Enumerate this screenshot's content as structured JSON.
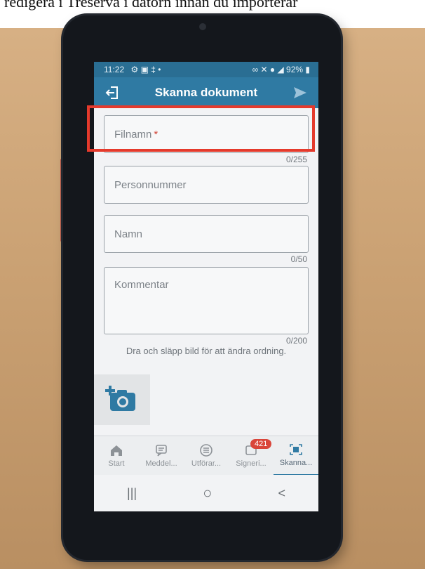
{
  "caption": {
    "text": "redigera i Treserva i datorn innan du importerar"
  },
  "statusbar": {
    "time": "11:22",
    "left_icons": "⚙ ▣ ‡ •",
    "right_icons": "∞ ✕ ● ◢",
    "battery": "92%"
  },
  "appbar": {
    "title": "Skanna dokument",
    "exit_icon": "exit-icon",
    "send_icon": "send-icon"
  },
  "form": {
    "filename": {
      "placeholder": "Filnamn",
      "required_mark": "*",
      "counter": "0/255"
    },
    "personnummer": {
      "placeholder": "Personnummer"
    },
    "namn": {
      "placeholder": "Namn",
      "counter": "0/50"
    },
    "kommentar": {
      "placeholder": "Kommentar",
      "counter": "0/200"
    },
    "hint": "Dra och släpp bild för att ändra ordning."
  },
  "bottomnav": {
    "items": [
      {
        "label": "Start",
        "icon": "home-icon"
      },
      {
        "label": "Meddel...",
        "icon": "message-icon"
      },
      {
        "label": "Utförar...",
        "icon": "list-icon"
      },
      {
        "label": "Signeri...",
        "icon": "sign-icon",
        "badge": "421"
      },
      {
        "label": "Skanna...",
        "icon": "scan-icon",
        "active": true
      }
    ]
  },
  "sysnav": {
    "recents": "|||",
    "home": "○",
    "back": "<"
  },
  "colors": {
    "appbar": "#2f7aa3",
    "highlight": "#e53a2c",
    "badge": "#d9453a"
  }
}
